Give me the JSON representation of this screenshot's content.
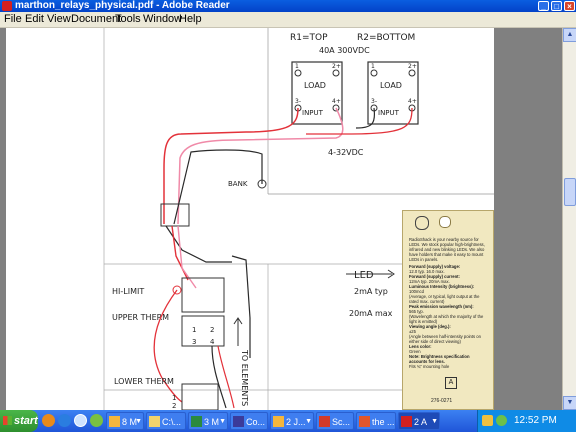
{
  "window": {
    "title": "marthon_relays_physical.pdf - Adobe Reader"
  },
  "menu": {
    "items": [
      "File",
      "Edit",
      "View",
      "Document",
      "Tools",
      "Window",
      "Help"
    ]
  },
  "drawing": {
    "r1_top": "R1=TOP",
    "r2_bottom": "R2=BOTTOM",
    "rating": "40A 300VDC",
    "relay1": {
      "load": "LOAD",
      "input": "INPUT",
      "t1": "1",
      "t2": "2+",
      "t3": "3-",
      "t4": "4+"
    },
    "relay2": {
      "load": "LOAD",
      "input": "INPUT",
      "t1": "1",
      "t2": "2+",
      "t3": "3-",
      "t4": "4+"
    },
    "vdc": "4-32VDC",
    "bank": "BANK",
    "hi_limit": "HI-LIMIT",
    "upper_therm": "UPPER THERM",
    "to_elements": "TO ELEMENTS",
    "led_note": "LED",
    "led_2ma": "2mA typ",
    "led_20ma": "20mA max",
    "lower_therm": "LOWER THERM",
    "lower_1": "1",
    "lower_2": "2",
    "up_1": "1",
    "up_2": "2",
    "up_3": "3",
    "up_4": "4"
  },
  "card": {
    "intro": "RadioShack is your nearby source for LEDs. We stock popular high-brightness, infrared and new blinking LEDs. We also have holders that make it easy to mount LEDs in panels.",
    "fv_label": "Forward (supply) voltage:",
    "fv_value": "12.0 typ. 16.0 max.",
    "fc_label": "Forward (supply) current:",
    "fc_value": "12mA typ. 20mA max.",
    "lum_label": "Luminous Intensity (brightness):",
    "lum_value": "100mcd",
    "lum_note": "(Average, or typical, light output at the rated max. current)",
    "peak_label": "Peak emission wavelength (nm):",
    "peak_value": "565 typ.",
    "peak_note": "(Wavelength at which the majority of the light is emitted)",
    "angle_label": "Viewing angle (deg.):",
    "angle_value": "±25",
    "angle_note": "(Angle between half-intensity points on either side of direct viewing)",
    "lens_label": "Lens color:",
    "lens_value": "Green",
    "note": "Note: Brightness specification accounts for lens.",
    "fits": "Fits ¾\" mounting hole",
    "part": "276-0271"
  },
  "taskbar": {
    "start": "start",
    "tasks": [
      "8 M",
      "C:\\...",
      "3 M",
      "Co...",
      "2 J...",
      "Sc...",
      "the ...",
      "2 A"
    ],
    "clock": "12:52 PM"
  },
  "colors": {
    "titlebar": "#0a5ee0",
    "taskbar": "#1f55d8",
    "wire_red": "#e3323a",
    "wire_pink": "#f08aa8",
    "wire_black": "#2a2a2a"
  }
}
